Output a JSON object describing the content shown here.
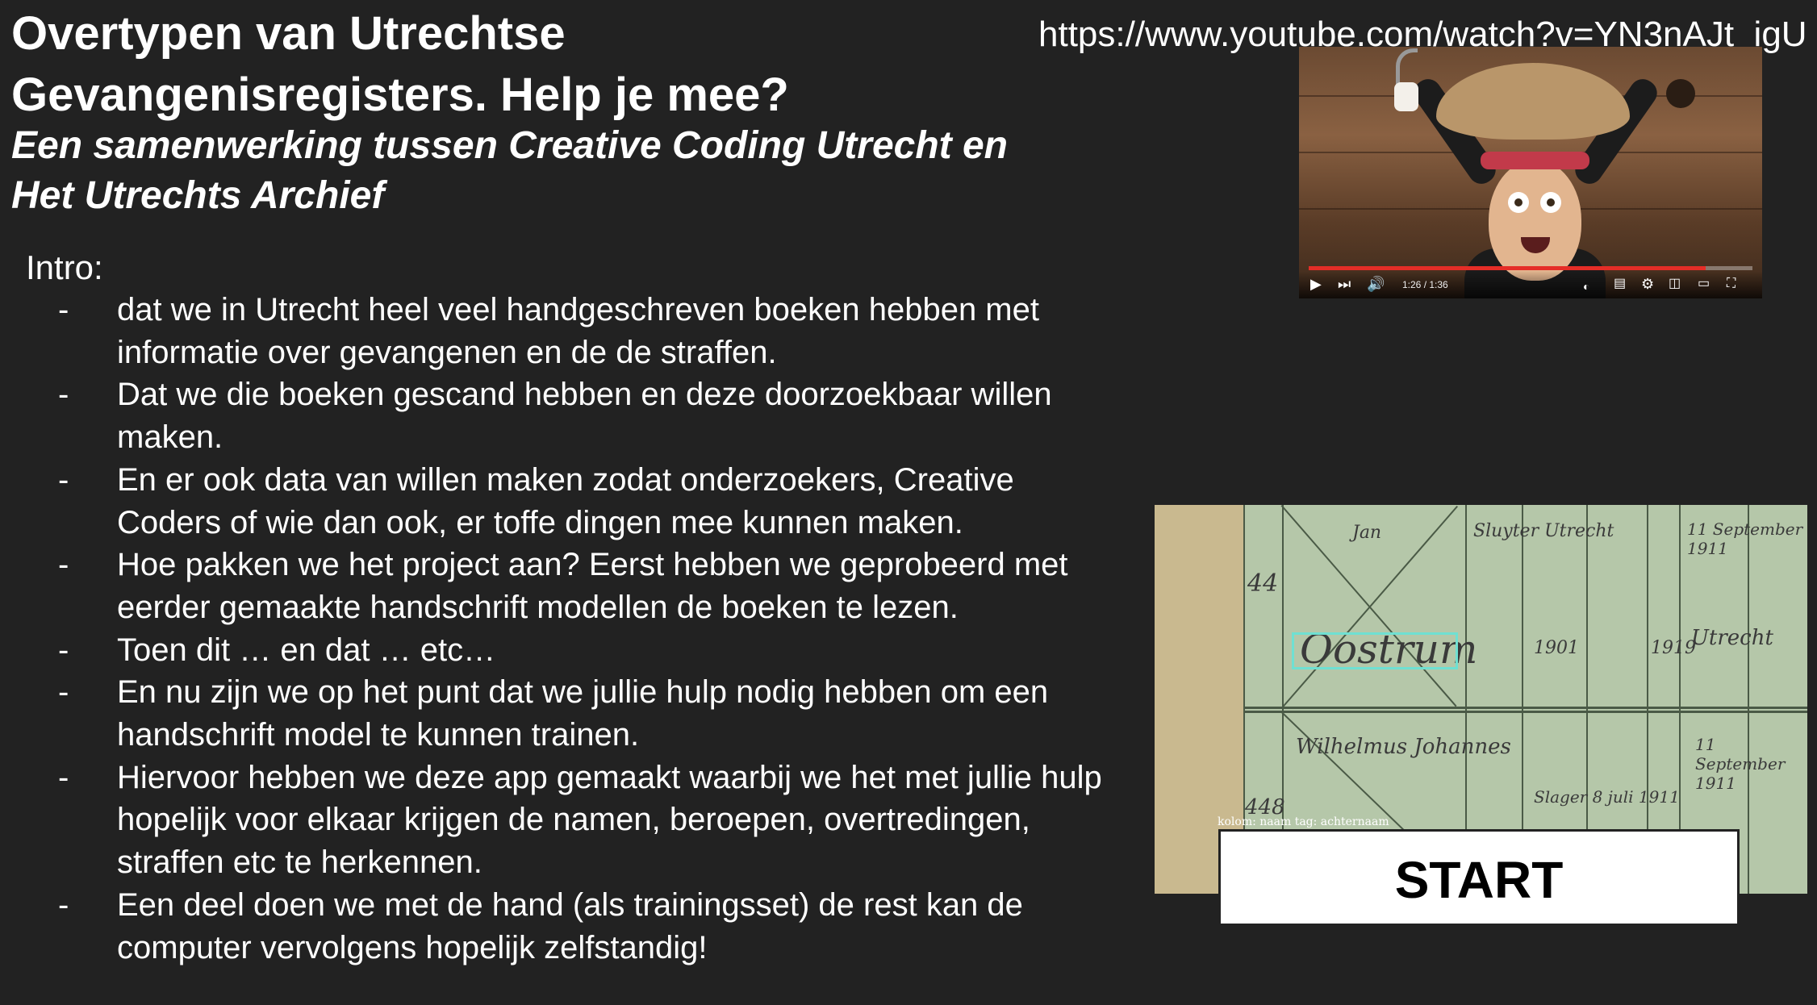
{
  "title": "Overtypen van Utrechtse Gevangenisregisters. Help je mee?",
  "subtitle": "Een samenwerking tussen Creative Coding Utrecht en Het Utrechts Archief",
  "video_url": "https://www.youtube.com/watch?v=YN3nAJt_igU",
  "intro_label": "Intro:",
  "bullet_marker": "-",
  "bullets": [
    [
      "dat we in Utrecht heel veel handgeschreven boeken hebben met",
      "informatie over gevangenen en de de straffen."
    ],
    [
      "Dat we die boeken gescand hebben en deze doorzoekbaar willen",
      "maken."
    ],
    [
      "En er ook data van willen maken zodat onderzoekers, Creative",
      "Coders of wie dan ook, er toffe dingen mee kunnen maken."
    ],
    [
      "Hoe pakken we het project aan? Eerst hebben we geprobeerd met",
      "eerder gemaakte handschrift modellen de boeken te lezen."
    ],
    [
      "Toen dit … en dat … etc…"
    ],
    [
      "En nu zijn we op het punt dat we jullie hulp nodig hebben om een",
      "handschrift model te kunnen trainen."
    ],
    [
      "Hiervoor hebben we deze app gemaakt waarbij we het met jullie hulp",
      "hopelijk voor elkaar krijgen de namen, beroepen, overtredingen,",
      "straffen etc te herkennen."
    ],
    [
      "Een deel doen we met de hand (als trainingsset) de rest kan de",
      "computer vervolgens hopelijk zelfstandig!"
    ]
  ],
  "video": {
    "time": "1:26 / 1:36",
    "progress": 0.895,
    "accent_color": "#e52d27"
  },
  "archive_scan": {
    "overlay_label": "kolom: naam  tag: achternaam"
  },
  "start_button": {
    "label": "START"
  },
  "colors": {
    "background": "#222222",
    "text": "#ffffff",
    "highlight": "#6fe0d2"
  }
}
